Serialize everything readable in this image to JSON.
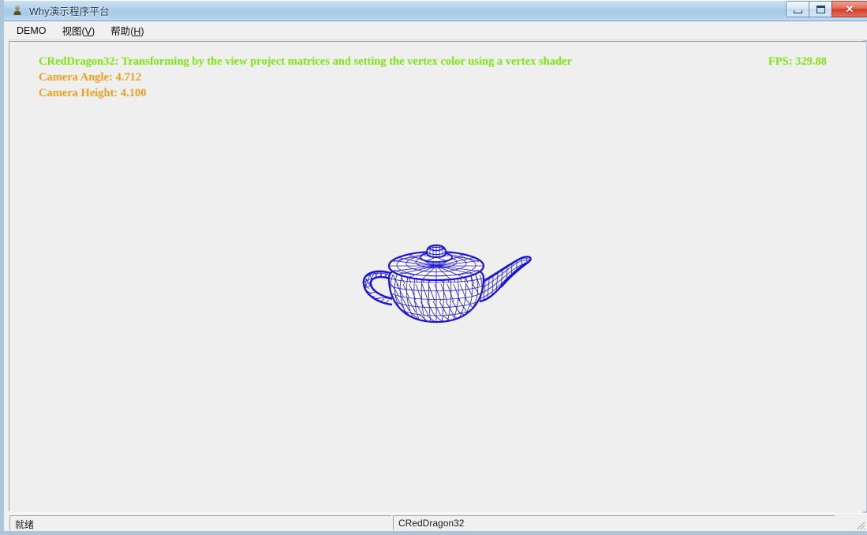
{
  "window": {
    "title": "Why演示程序平台",
    "icon": "app-person-icon",
    "controls": {
      "minimize_label": "—",
      "maximize_label": "❐",
      "close_label": "✕"
    }
  },
  "menubar": {
    "items": [
      {
        "label": "DEMO",
        "accel": ""
      },
      {
        "label": "视图(",
        "accel": "V",
        "suffix": ")"
      },
      {
        "label": "帮助(",
        "accel": "H",
        "suffix": ")"
      }
    ]
  },
  "viewport": {
    "background_color": "#efefef",
    "hud": {
      "title_color": "#7ce810",
      "value_color": "#f0a020",
      "title_line": "CRedDragon32: Transforming by the view project matrices and setting the vertex color using a vertex shader",
      "fps_label": "FPS: 329.88",
      "camera_angle": "Camera Angle: 4.712",
      "camera_height": "Camera Height: 4.100"
    },
    "model": {
      "name": "utah-teapot-wireframe",
      "wireframe_color": "#1a14d8",
      "fill_color": "#ffffff"
    }
  },
  "statusbar": {
    "ready_text": "就绪",
    "class_name": "CRedDragon32"
  }
}
